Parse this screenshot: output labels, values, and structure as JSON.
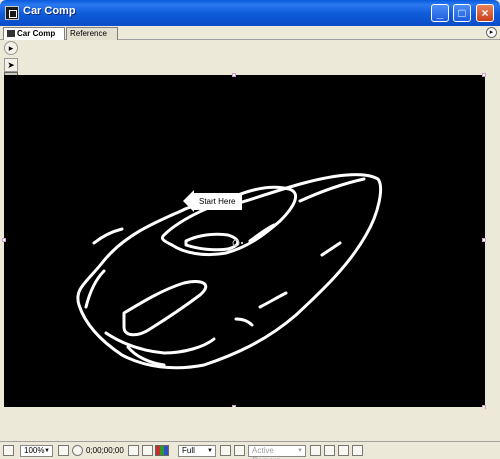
{
  "window": {
    "title": "Car Comp"
  },
  "tabs": [
    {
      "label": "Car Comp",
      "active": true
    },
    {
      "label": "Reference",
      "active": false
    }
  ],
  "viewer": {
    "background_color": "#000000",
    "annotation": {
      "text": "Start Here"
    }
  },
  "toolbar": {
    "tools": [
      "selection-tool",
      "brush-tool",
      "eraser-tool",
      "round-brush-hard",
      "round-brush-soft",
      "square-brush",
      "undo-tool",
      "eyedropper-tool",
      "color-swatch"
    ],
    "selected": "brush-tool"
  },
  "statusbar": {
    "zoom": "100%",
    "timecode": "0;00;00;00",
    "resolution": "Full",
    "camera": "Active Camera"
  }
}
